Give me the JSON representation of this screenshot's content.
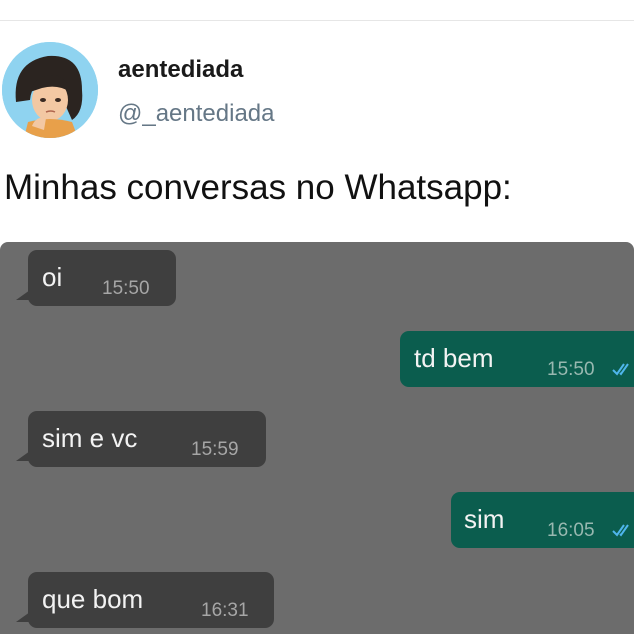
{
  "tweet": {
    "display_name": "aentediada",
    "handle": "@_aentediada",
    "text": "Minhas conversas no Whatsapp:"
  },
  "chat": {
    "messages": [
      {
        "direction": "incoming",
        "text": "oi",
        "time": "15:50"
      },
      {
        "direction": "outgoing",
        "text": "td bem",
        "time": "15:50",
        "status": "read"
      },
      {
        "direction": "incoming",
        "text": "sim e vc",
        "time": "15:59"
      },
      {
        "direction": "outgoing",
        "text": "sim",
        "time": "16:05",
        "status": "read"
      },
      {
        "direction": "incoming",
        "text": "que bom",
        "time": "16:31"
      }
    ]
  },
  "colors": {
    "chat_background": "#6c6c6c",
    "incoming_bubble": "#3f3f3f",
    "outgoing_bubble": "#0b5d4e",
    "read_ticks": "#4fb6ec"
  }
}
